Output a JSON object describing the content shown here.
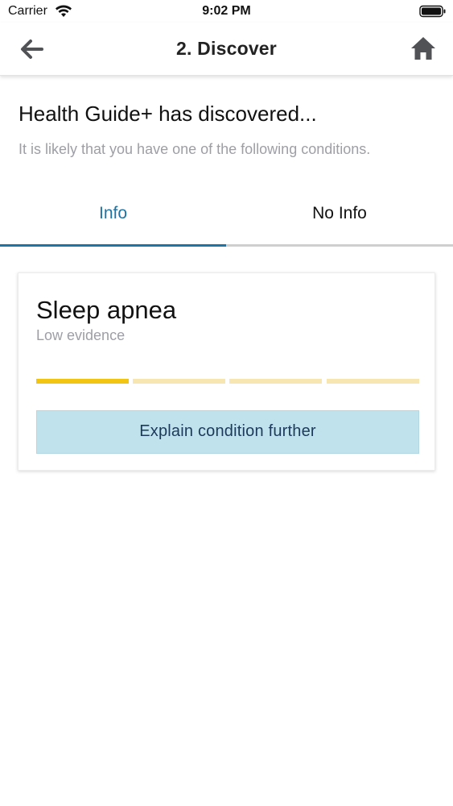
{
  "status_bar": {
    "carrier": "Carrier",
    "time": "9:02 PM",
    "wifi_icon": "wifi-icon",
    "battery_icon": "battery-icon"
  },
  "header": {
    "title": "2. Discover",
    "back_icon": "arrow-left-icon",
    "home_icon": "home-icon"
  },
  "main": {
    "heading": "Health Guide+ has discovered...",
    "subtitle": "It is likely that you have one of the following conditions.",
    "tabs": [
      {
        "label": "Info",
        "active": true
      },
      {
        "label": "No Info",
        "active": false
      }
    ],
    "condition_card": {
      "title": "Sleep apnea",
      "evidence_label": "Low evidence",
      "evidence_level": 1,
      "evidence_max": 4,
      "button_label": "Explain condition further"
    }
  },
  "colors": {
    "accent": "#1c75a6",
    "evidence_filled": "#f2c414",
    "evidence_empty": "#f7e6b2",
    "button_bg": "#c0e2ec",
    "button_text": "#1d3a5b",
    "muted_text": "#9e9ea6",
    "tab_inactive_line": "#cfcfcf"
  }
}
